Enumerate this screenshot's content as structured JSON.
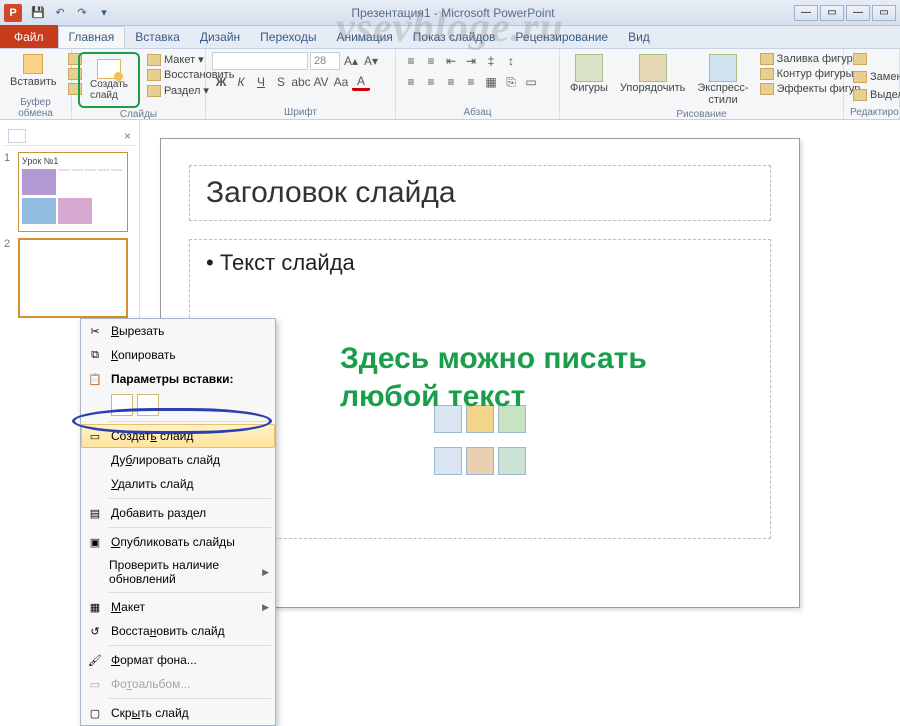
{
  "title": "Презентация1 - Microsoft PowerPoint",
  "watermark": "vsevbloge.ru",
  "qat": {
    "save": "💾",
    "undo": "↶",
    "redo": "↷"
  },
  "winbtns": {
    "min": "—",
    "max": "▭",
    "close": "✕"
  },
  "tabs": {
    "file": "Файл",
    "home": "Главная",
    "insert": "Вставка",
    "design": "Дизайн",
    "transitions": "Переходы",
    "animation": "Анимация",
    "slideshow": "Показ слайдов",
    "review": "Рецензирование",
    "view": "Вид"
  },
  "ribbon": {
    "clipboard": {
      "paste": "Вставить",
      "label": "Буфер обмена"
    },
    "slides": {
      "new_slide": "Создать слайд",
      "layout": "Макет",
      "reset": "Восстановить",
      "section": "Раздел",
      "label": "Слайды"
    },
    "font": {
      "size": "28",
      "label": "Шрифт"
    },
    "paragraph": {
      "label": "Абзац"
    },
    "drawing": {
      "shapes": "Фигуры",
      "arrange": "Упорядочить",
      "quick_styles": "Экспресс-стили",
      "fill": "Заливка фигуры",
      "outline": "Контур фигуры",
      "effects": "Эффекты фигур",
      "label": "Рисование"
    },
    "editing": {
      "replace": "Замен",
      "select": "Выдел",
      "label": "Редактиро"
    }
  },
  "thumbs": {
    "slide1": {
      "num": "1",
      "title": "Урок №1"
    },
    "slide2": {
      "num": "2"
    }
  },
  "slide": {
    "title": "Заголовок слайда",
    "bullet1": "Текст слайда"
  },
  "overlay": {
    "line1": "Здесь можно писать",
    "line2": "любой текст"
  },
  "context": {
    "cut": "Вырезать",
    "copy": "Копировать",
    "paste_options": "Параметры вставки:",
    "new_slide": "Создать слайд",
    "duplicate": "Дублировать слайд",
    "delete": "Удалить слайд",
    "add_section": "Добавить раздел",
    "publish": "Опубликовать слайды",
    "check_updates": "Проверить наличие обновлений",
    "layout": "Макет",
    "reset": "Восстановить слайд",
    "format_bg": "Формат фона...",
    "photo_album": "Фотоальбом...",
    "hide": "Скрыть слайд"
  }
}
